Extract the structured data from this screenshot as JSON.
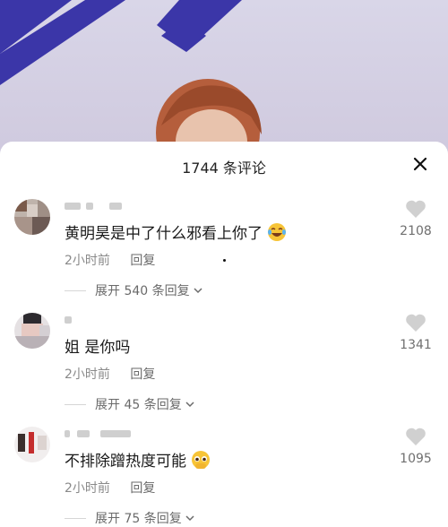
{
  "sheet": {
    "title": "1744 条评论"
  },
  "comments": [
    {
      "text": "黄明昊是中了什么邪看上你了",
      "emoji_icon": "laughing-tears-emoji",
      "time": "2小时前",
      "reply_label": "回复",
      "expand_label": "展开 540 条回复",
      "likes": "2108"
    },
    {
      "text": "姐 是你吗",
      "emoji_icon": "",
      "time": "2小时前",
      "reply_label": "回复",
      "expand_label": "展开 45 条回复",
      "likes": "1341"
    },
    {
      "text": "不排除蹭热度可能",
      "emoji_icon": "pleading-face-emoji",
      "time": "2小时前",
      "reply_label": "回复",
      "expand_label": "展开 75 条回复",
      "likes": "1095"
    }
  ],
  "colors": {
    "sheet_bg": "#ffffff",
    "text_primary": "#1a1a1a",
    "text_secondary": "#8a8a8a",
    "heart_gray": "#d0d0d0",
    "video_blue": "#3b36a8"
  }
}
